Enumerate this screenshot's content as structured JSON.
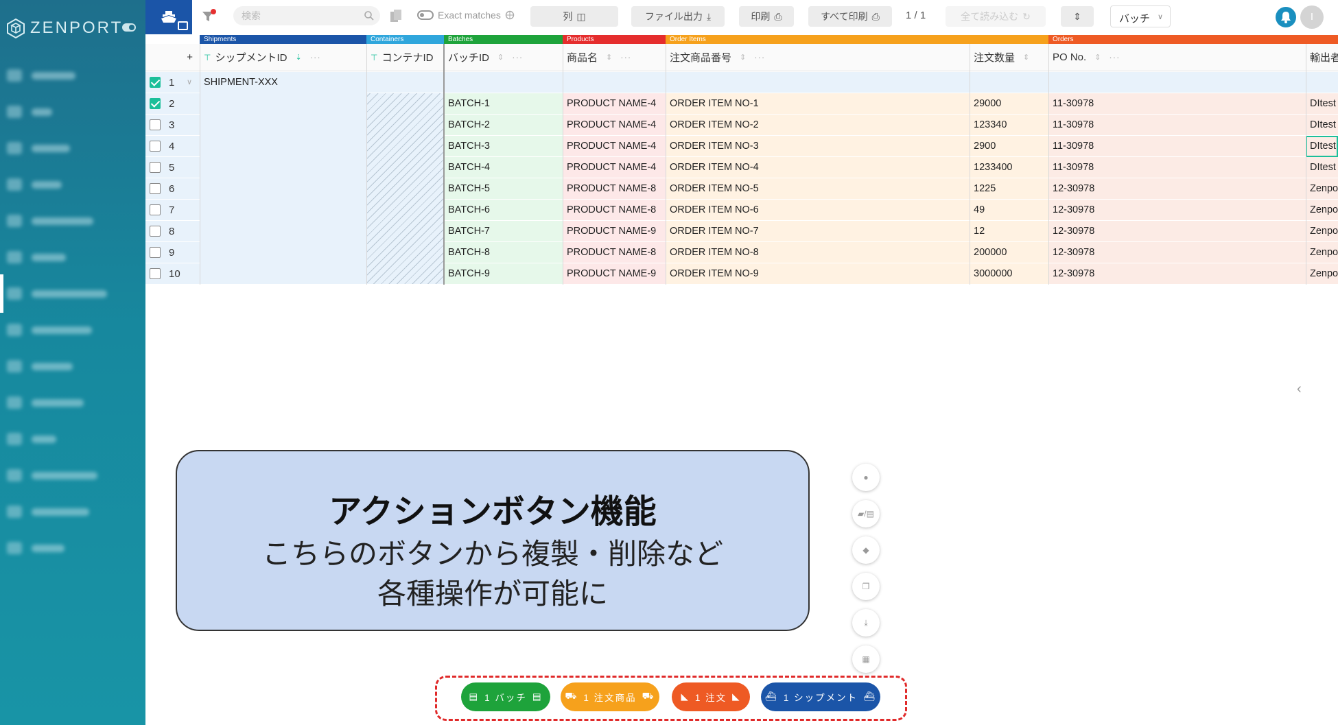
{
  "app": {
    "brand": "ZENPORT"
  },
  "toolbar": {
    "search_placeholder": "検索",
    "exact_matches": "Exact matches",
    "columns": "列",
    "export": "ファイル出力",
    "print": "印刷",
    "print_all": "すべて印刷",
    "page": "1 / 1",
    "reload_all": "全て読み込む",
    "view_select": "バッチ",
    "avatar_initial": "I"
  },
  "entities": {
    "shipments": "Shipments",
    "containers": "Containers",
    "batches": "Batches",
    "products": "Products",
    "order_items": "Order Items",
    "orders": "Orders"
  },
  "columns": {
    "shipment_id": "シップメントID",
    "container_id": "コンテナID",
    "batch_id": "バッチID",
    "product_name": "商品名",
    "order_item_no": "注文商品番号",
    "quantity": "注文数量",
    "po_no": "PO No.",
    "exporter": "輸出者"
  },
  "grid": {
    "shipment": "SHIPMENT-XXX",
    "rows": [
      {
        "num": "1",
        "checked": true,
        "batch": "",
        "product": "",
        "item": "",
        "qty": "",
        "po": "",
        "exporter": ""
      },
      {
        "num": "2",
        "checked": true,
        "batch": "BATCH-1",
        "product": "PRODUCT NAME-4",
        "item": "ORDER ITEM NO-1",
        "qty": "29000",
        "po": "11-30978",
        "exporter": "DItest"
      },
      {
        "num": "3",
        "checked": false,
        "batch": "BATCH-2",
        "product": "PRODUCT NAME-4",
        "item": "ORDER ITEM NO-2",
        "qty": "123340",
        "po": "11-30978",
        "exporter": "DItest"
      },
      {
        "num": "4",
        "checked": false,
        "batch": "BATCH-3",
        "product": "PRODUCT NAME-4",
        "item": "ORDER ITEM NO-3",
        "qty": "2900",
        "po": "11-30978",
        "exporter": "DItest"
      },
      {
        "num": "5",
        "checked": false,
        "batch": "BATCH-4",
        "product": "PRODUCT NAME-4",
        "item": "ORDER ITEM NO-4",
        "qty": "1233400",
        "po": "11-30978",
        "exporter": "DItest"
      },
      {
        "num": "6",
        "checked": false,
        "batch": "BATCH-5",
        "product": "PRODUCT NAME-8",
        "item": "ORDER ITEM NO-5",
        "qty": "1225",
        "po": "12-30978",
        "exporter": "Zenpo"
      },
      {
        "num": "7",
        "checked": false,
        "batch": "BATCH-6",
        "product": "PRODUCT NAME-8",
        "item": "ORDER ITEM NO-6",
        "qty": "49",
        "po": "12-30978",
        "exporter": "Zenpo"
      },
      {
        "num": "8",
        "checked": false,
        "batch": "BATCH-7",
        "product": "PRODUCT NAME-9",
        "item": "ORDER ITEM NO-7",
        "qty": "12",
        "po": "12-30978",
        "exporter": "Zenpo"
      },
      {
        "num": "9",
        "checked": false,
        "batch": "BATCH-8",
        "product": "PRODUCT NAME-8",
        "item": "ORDER ITEM NO-8",
        "qty": "200000",
        "po": "12-30978",
        "exporter": "Zenpo"
      },
      {
        "num": "10",
        "checked": false,
        "batch": "BATCH-9",
        "product": "PRODUCT NAME-9",
        "item": "ORDER ITEM NO-9",
        "qty": "3000000",
        "po": "12-30978",
        "exporter": "Zenpo"
      }
    ]
  },
  "callout": {
    "title": "アクションボタン機能",
    "line1": "こちらのボタンから複製・削除など",
    "line2": "各種操作が可能に"
  },
  "actions": [
    {
      "label": "1 バッチ",
      "color": "#1ea33b",
      "icon": "batch-icon"
    },
    {
      "label": "1 注文商品",
      "color": "#f6a11c",
      "icon": "cart-icon"
    },
    {
      "label": "1 注文",
      "color": "#ee5a24",
      "icon": "order-icon"
    },
    {
      "label": "1 シップメント",
      "color": "#1b55a8",
      "icon": "ship-icon"
    }
  ],
  "colors": {
    "shipments": "#1b55a8",
    "containers": "#2fa6dc",
    "batches": "#1ea33b",
    "products": "#e52d2d",
    "order_items": "#f6a11c",
    "orders": "#ee5a24",
    "check": "#1bbf9a"
  }
}
